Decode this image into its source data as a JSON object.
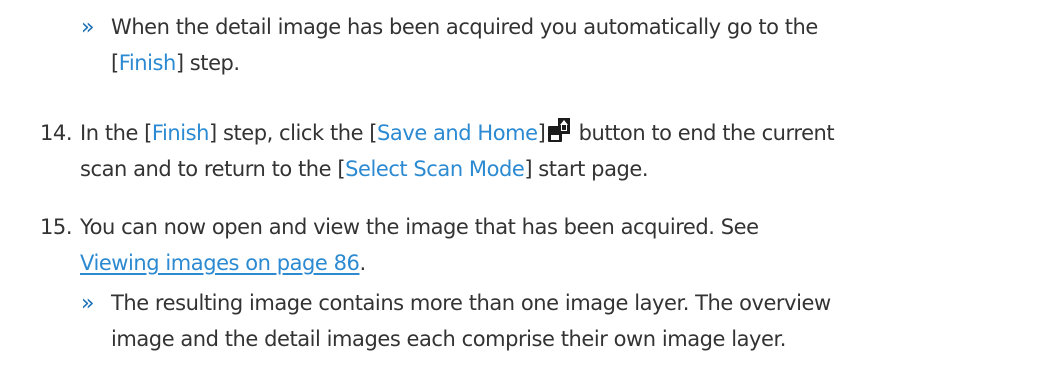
{
  "result_1": {
    "marker": "»",
    "line1": "When the detail image has been acquired you automatically go to the",
    "line2_open": "[",
    "line2_term": "Finish",
    "line2_close": "] step."
  },
  "step_14": {
    "number": "14.",
    "line1_a": "In the [",
    "line1_term1": "Finish",
    "line1_b": "] step, click the [",
    "line1_term2": "Save and Home",
    "line1_c": "]",
    "line1_icon": "save-and-home-icon",
    "line1_d": "button to end the current",
    "line2_a": "scan and to return to the [",
    "line2_term": "Select Scan Mode",
    "line2_b": "] start page."
  },
  "step_15": {
    "number": "15.",
    "line1": "You can now open and view the image that has been acquired. See",
    "line2_link": "Viewing images on page 86",
    "line2_after": "."
  },
  "result_2": {
    "marker": "»",
    "line1": "The resulting image contains more than one image layer. The overview",
    "line2": "image and the detail images each comprise their own image layer."
  },
  "colors": {
    "body_text": "#333333",
    "ui_term": "#2b8ad1",
    "link": "#2b8ad1",
    "result_marker": "#1a6fb5"
  }
}
